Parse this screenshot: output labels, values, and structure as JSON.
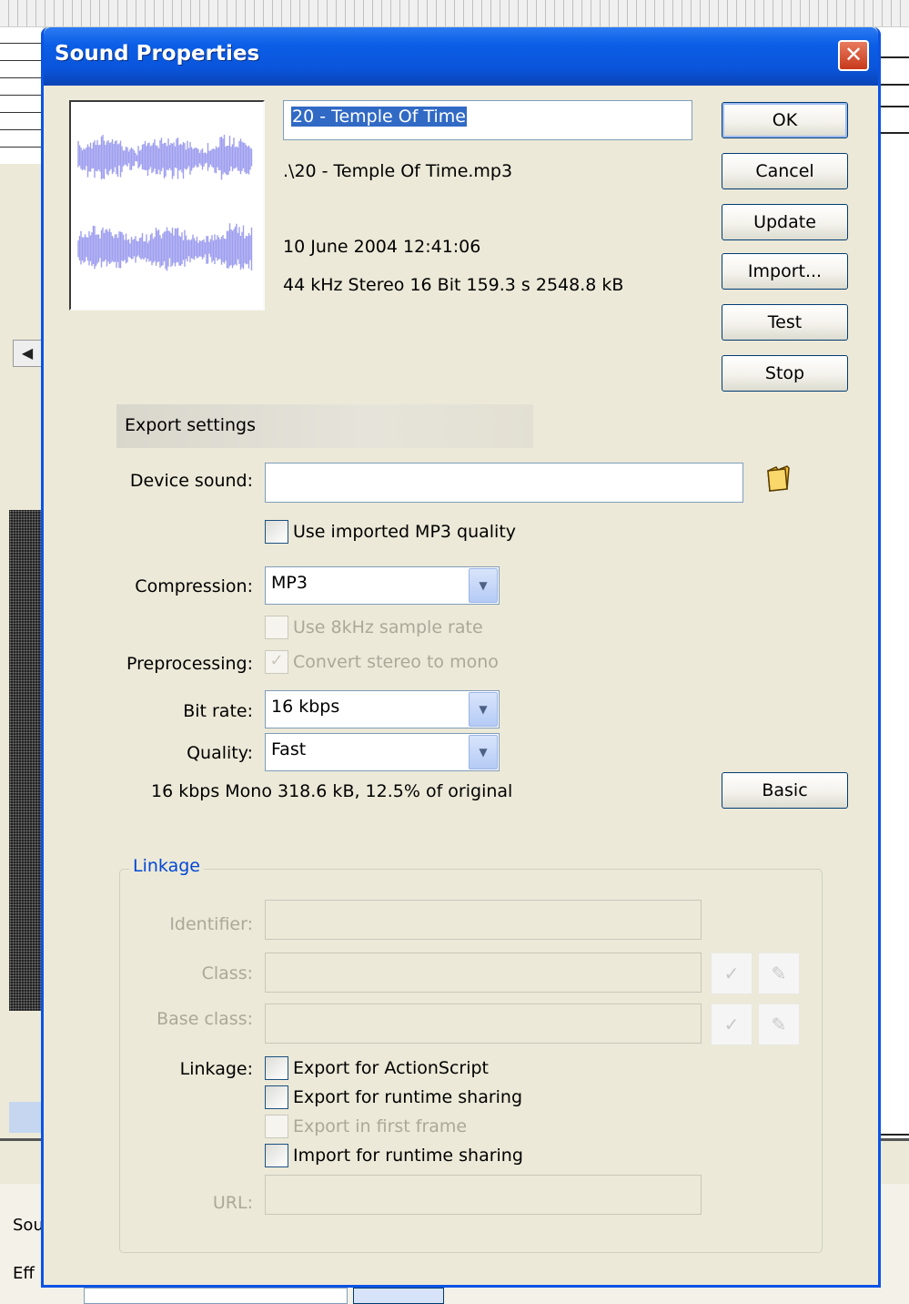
{
  "dialog": {
    "title": "Sound Properties",
    "close_icon": "close-icon"
  },
  "sound": {
    "name": "20 - Temple Of Time",
    "path": ".\\20 - Temple Of Time.mp3",
    "date": "10 June 2004  12:41:06",
    "format": "44 kHz Stereo 16 Bit 159.3 s 2548.8 kB"
  },
  "buttons": {
    "ok": "OK",
    "cancel": "Cancel",
    "update": "Update",
    "import": "Import...",
    "test": "Test",
    "stop": "Stop",
    "basic": "Basic"
  },
  "export_settings": {
    "header": "Export settings",
    "device_sound_label": "Device sound:",
    "device_sound_value": "",
    "folder_icon": "folder-icon",
    "use_imported_mp3_label": "Use imported MP3 quality",
    "compression_label": "Compression:",
    "compression_value": "MP3",
    "use_8khz_label": "Use 8kHz sample rate",
    "preprocessing_label": "Preprocessing:",
    "convert_stereo_label": "Convert stereo to mono",
    "bit_rate_label": "Bit rate:",
    "bit_rate_value": "16 kbps",
    "quality_label": "Quality:",
    "quality_value": "Fast",
    "summary": "16 kbps  Mono 318.6 kB, 12.5% of original"
  },
  "linkage": {
    "legend": "Linkage",
    "identifier_label": "Identifier:",
    "class_label": "Class:",
    "base_class_label": "Base class:",
    "linkage_label": "Linkage:",
    "export_actionscript": "Export for ActionScript",
    "export_runtime_sharing": "Export for runtime sharing",
    "export_first_frame": "Export in first frame",
    "import_runtime_sharing": "Import for runtime sharing",
    "url_label": "URL:"
  },
  "background": {
    "label_sou": "Sou",
    "label_eff": "Eff"
  },
  "colors": {
    "titlebar": "#0a55db",
    "selection": "#316ac5",
    "waveform": "#9e9ef0",
    "linkage_legend": "#0046d5"
  }
}
